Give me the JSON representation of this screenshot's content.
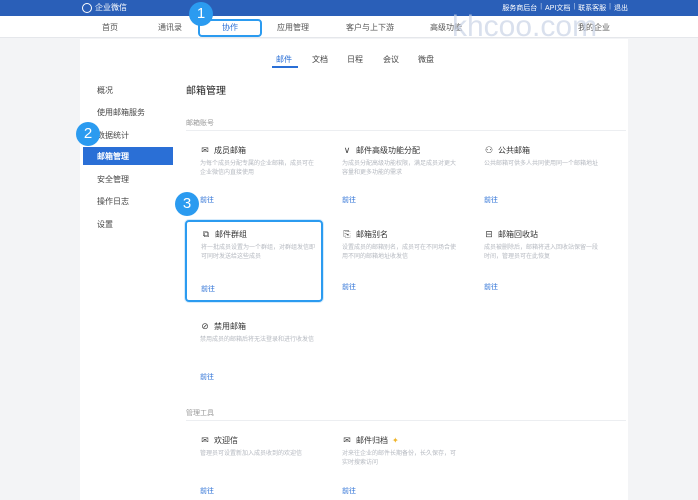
{
  "app": {
    "name": "企业微信"
  },
  "top_links": [
    "服务商后台",
    "API文档",
    "联系客服",
    "退出"
  ],
  "main_nav": [
    "首页",
    "通讯录",
    "协作",
    "应用管理",
    "客户与上下游",
    "高级功能",
    "我的企业"
  ],
  "sub_nav": [
    "邮件",
    "文档",
    "日程",
    "会议",
    "微盘"
  ],
  "sidebar": [
    "概况",
    "使用邮箱服务",
    "数据统计",
    "邮箱管理",
    "安全管理",
    "操作日志",
    "设置"
  ],
  "page": {
    "title": "邮箱管理",
    "section_accounts": "邮箱账号",
    "section_tools": "管理工具"
  },
  "cards": [
    {
      "title": "成员邮箱",
      "icon": "mail-icon",
      "desc": "为每个成员分配专属的企业邮箱，成员可在企业微信内直接使用",
      "go": "前往"
    },
    {
      "title": "邮件高级功能分配",
      "icon": "v-mark-icon",
      "desc": "为成员分配高级功能权限，满足成员对更大容量和更多功能的需求",
      "go": "前往"
    },
    {
      "title": "公共邮箱",
      "icon": "people-icon",
      "desc": "公共邮箱可供多人共同使用同一个邮箱地址",
      "go": "前往"
    },
    {
      "title": "邮件群组",
      "icon": "group-icon",
      "desc": "将一批成员设置为一个群组，对群组发信即可同时发送给这些成员",
      "go": "前往"
    },
    {
      "title": "邮箱别名",
      "icon": "bookmark-icon",
      "desc": "设置成员的邮箱别名，成员可在不同场合使用不同的邮箱地址收发信",
      "go": "前往"
    },
    {
      "title": "邮箱回收站",
      "icon": "trash-icon",
      "desc": "成员被删除后，邮箱将进入回收站保留一段时间，管理员可在此恢复",
      "go": "前往"
    },
    {
      "title": "禁用邮箱",
      "icon": "ban-icon",
      "desc": "禁用成员的邮箱后将无法登录和进行收发信",
      "go": "前往"
    },
    {
      "title": "欢迎信",
      "icon": "welcome-mail-icon",
      "desc": "管理员可设置新加入成员收到的欢迎信",
      "go": "前往"
    },
    {
      "title": "邮件归档",
      "icon": "archive-mail-icon",
      "desc": "对来往企业的邮件长期备份，长久保存，可实时搜索访问",
      "go": "前往"
    }
  ],
  "annotations": {
    "badge1": "1",
    "badge2": "2",
    "badge3": "3"
  },
  "watermark": "khcoo.com",
  "colors": {
    "brand": "#2a5fb8",
    "accent": "#2a6fd6",
    "highlight": "#2b9bf0"
  }
}
